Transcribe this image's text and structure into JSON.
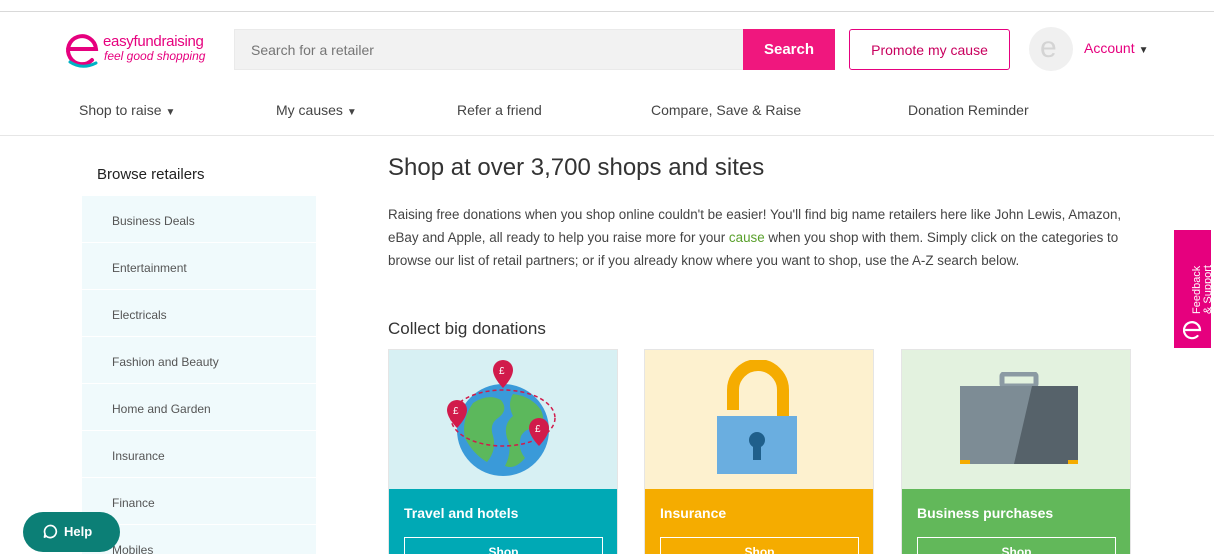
{
  "header": {
    "logo_line1": "easyfundraising",
    "logo_line2": "feel good shopping",
    "search_placeholder": "Search for a retailer",
    "search_button": "Search",
    "promote_button": "Promote my cause",
    "avatar_letter": "e",
    "account_label": "Account",
    "account_caret": "▼"
  },
  "nav": {
    "items": [
      {
        "label": "Shop to raise",
        "caret": "▼"
      },
      {
        "label": "My causes",
        "caret": "▼"
      },
      {
        "label": "Refer a friend"
      },
      {
        "label": "Compare, Save & Raise"
      },
      {
        "label": "Donation Reminder"
      }
    ]
  },
  "sidebar": {
    "title": "Browse retailers",
    "items": [
      {
        "label": "Business Deals"
      },
      {
        "label": "Entertainment"
      },
      {
        "label": "Electricals"
      },
      {
        "label": "Fashion and Beauty"
      },
      {
        "label": "Home and Garden"
      },
      {
        "label": "Insurance"
      },
      {
        "label": "Finance"
      },
      {
        "label": "Mobiles"
      }
    ]
  },
  "main": {
    "heading": "Shop at over 3,700 shops and sites",
    "intro_before_link": "Raising free donations when you shop online couldn't be easier! You'll find big name retailers here like John Lewis, Amazon, eBay and Apple, all ready to help you raise more for your ",
    "intro_link": "cause",
    "intro_after_link": " when you shop with them. Simply click on the categories to browse our list of retail partners; or if you already know where you want to shop, use the A-Z search below.",
    "collect_title": "Collect big donations",
    "cards": [
      {
        "title": "Travel and hotels",
        "button": "Shop",
        "bar_color": "#00a9b5",
        "img_bg": "#d7f0f3",
        "icon": "globe-icon"
      },
      {
        "title": "Insurance",
        "button": "Shop",
        "bar_color": "#f5ac00",
        "img_bg": "#fdf1cf",
        "icon": "padlock-icon"
      },
      {
        "title": "Business purchases",
        "button": "Shop",
        "bar_color": "#62b85a",
        "img_bg": "#e3f2df",
        "icon": "briefcase-icon"
      }
    ]
  },
  "help": {
    "label": "Help"
  },
  "feedback": {
    "label_line1": "Feedback",
    "label_line2": "& Support"
  },
  "colors": {
    "brand_pink": "#e6007e",
    "search_pink": "#f0177e",
    "help_teal": "#0c7f76",
    "link_green": "#5aa02c"
  }
}
